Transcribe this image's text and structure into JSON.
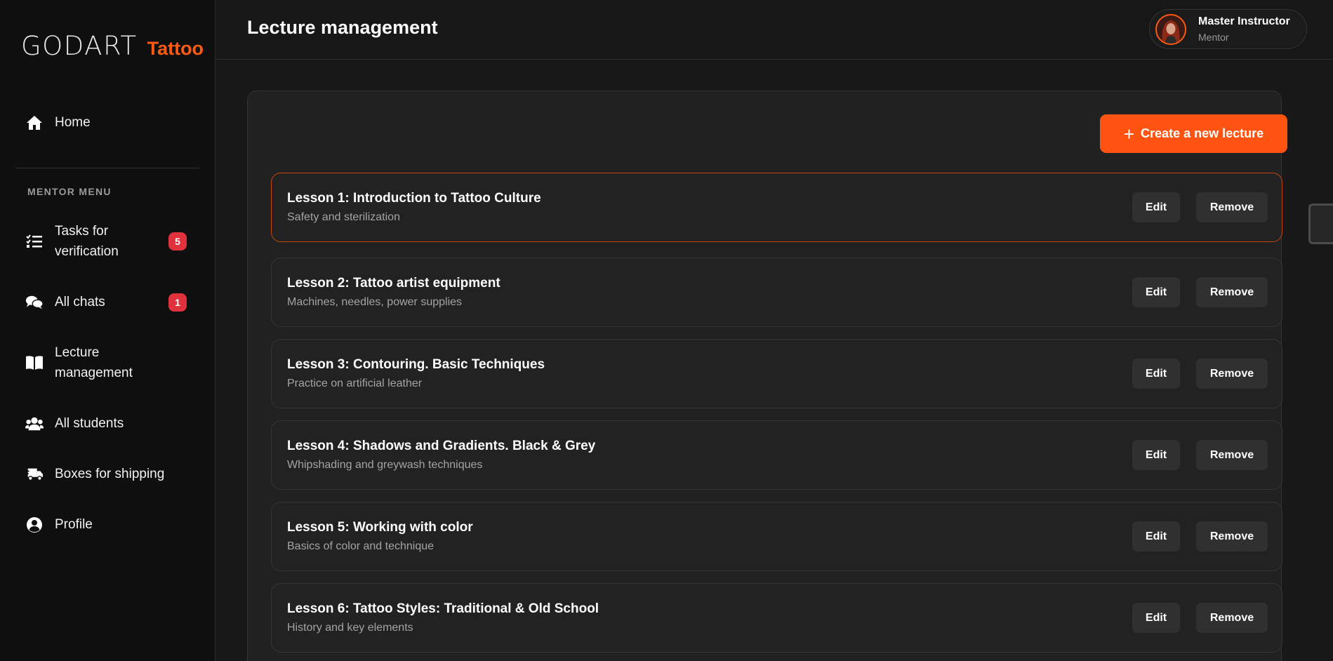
{
  "brand": {
    "main": "GODART",
    "accent": "Tattoo",
    "accent_color": "#ff5a12"
  },
  "sidebar": {
    "home": {
      "label": "Home",
      "icon": "home-icon"
    },
    "section_label": "MENTOR MENU",
    "items": [
      {
        "label": "Tasks for verification",
        "icon": "task-list-icon",
        "badge": "5"
      },
      {
        "label": "All chats",
        "icon": "chat-bubbles-icon",
        "badge": "1"
      },
      {
        "label": "Lecture management",
        "icon": "open-book-icon",
        "badge": null
      },
      {
        "label": "All students",
        "icon": "users-icon",
        "badge": null
      },
      {
        "label": "Boxes for shipping",
        "icon": "delivery-truck-icon",
        "badge": null
      },
      {
        "label": "Profile",
        "icon": "user-circle-icon",
        "badge": null
      }
    ]
  },
  "header": {
    "title": "Lecture management",
    "user": {
      "name": "Master Instructor",
      "role": "Mentor"
    }
  },
  "main": {
    "create_button": "Create a new lecture",
    "edit_label": "Edit",
    "remove_label": "Remove",
    "lessons": [
      {
        "title": "Lesson 1: Introduction to Tattoo Culture",
        "subtitle": "Safety and sterilization",
        "active": true
      },
      {
        "title": "Lesson 2: Tattoo artist equipment",
        "subtitle": "Machines, needles, power supplies",
        "active": false
      },
      {
        "title": "Lesson 3: Contouring. Basic Techniques",
        "subtitle": "Practice on artificial leather",
        "active": false
      },
      {
        "title": "Lesson 4: Shadows and Gradients. Black & Grey",
        "subtitle": "Whipshading and greywash techniques",
        "active": false
      },
      {
        "title": "Lesson 5: Working with color",
        "subtitle": "Basics of color and technique",
        "active": false
      },
      {
        "title": "Lesson 6: Tattoo Styles: Traditional & Old School",
        "subtitle": "History and key elements",
        "active": false
      }
    ]
  },
  "colors": {
    "accent": "#ff5411",
    "badge": "#e0323c",
    "background": "#181818",
    "sidebar": "#0f0f0f"
  }
}
